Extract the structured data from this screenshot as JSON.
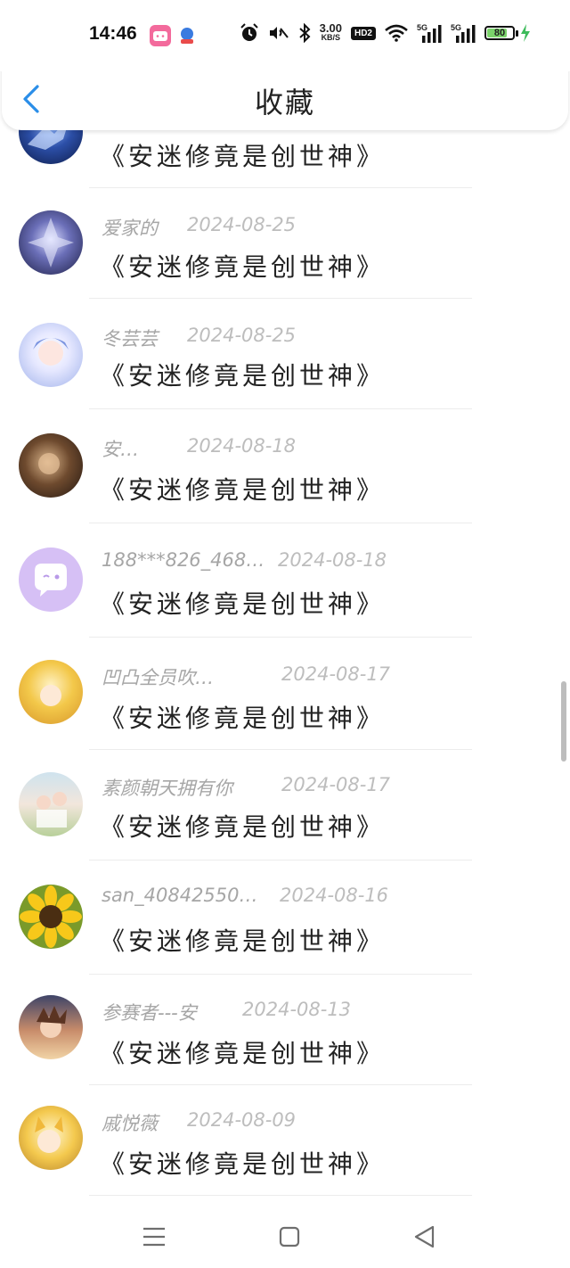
{
  "status_bar": {
    "time": "14:46",
    "net_speed_value": "3.00",
    "net_speed_unit": "KB/S",
    "hd_badge": "HD2",
    "signal1_label": "5G",
    "signal2_label": "5G",
    "battery_level": "80",
    "battery_color": "#7bd36b"
  },
  "header": {
    "title": "收藏",
    "back_icon": "chevron-left-icon",
    "accent_color": "#2a8ee8"
  },
  "favorites": [
    {
      "user": "",
      "date": "",
      "content": "《安迷修竟是创世神》",
      "avatar": "dragon-avatar"
    },
    {
      "user": "爱家的",
      "date": "2024-08-25",
      "content": "《安迷修竟是创世神》",
      "avatar": "mecha-avatar"
    },
    {
      "user": "冬芸芸",
      "date": "2024-08-25",
      "content": "《安迷修竟是创世神》",
      "avatar": "anime-girl-avatar"
    },
    {
      "user": "安…",
      "date": "2024-08-18",
      "content": "《安迷修竟是创世神》",
      "avatar": "dark-anime-avatar"
    },
    {
      "user": "188***826_468…",
      "date": "2024-08-18",
      "content": "《安迷修竟是创世神》",
      "avatar": "chat-bubble-avatar"
    },
    {
      "user": "凹凸全员吹…",
      "date": "2024-08-17",
      "content": "《安迷修竟是创世神》",
      "avatar": "blonde-anime-avatar"
    },
    {
      "user": "素颜朝天拥有你",
      "date": "2024-08-17",
      "content": "《安迷修竟是创世神》",
      "avatar": "photo-girls-avatar"
    },
    {
      "user": "san_40842550…",
      "date": "2024-08-16",
      "content": "《安迷修竟是创世神》",
      "avatar": "sunflower-avatar"
    },
    {
      "user": "参赛者---安",
      "date": "2024-08-13",
      "content": "《安迷修竟是创世神》",
      "avatar": "sunset-anime-avatar"
    },
    {
      "user": "戚悦薇",
      "date": "2024-08-09",
      "content": "《安迷修竟是创世神》",
      "avatar": "yellow-anime-avatar"
    }
  ],
  "bottom_nav": {
    "menu_icon": "menu-icon",
    "home_icon": "home-square-icon",
    "back_icon": "back-triangle-icon"
  }
}
